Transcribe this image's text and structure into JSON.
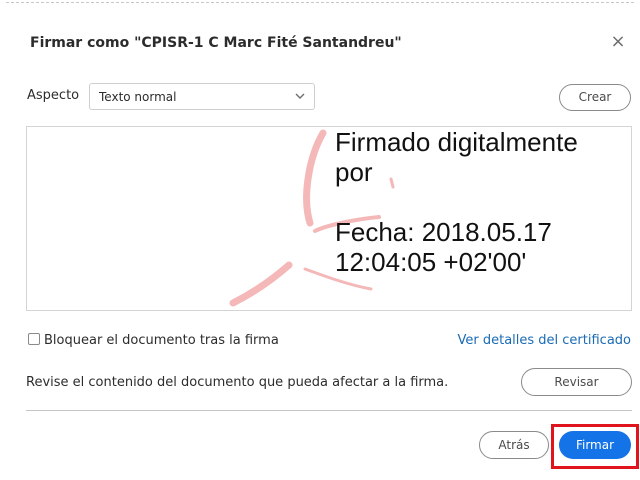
{
  "dialog": {
    "title": "Firmar como \"CPISR-1 C Marc Fité Santandreu\"",
    "close_symbol": "×"
  },
  "aspect": {
    "label": "Aspecto",
    "selected": "Texto normal",
    "create_label": "Crear"
  },
  "signature_preview": {
    "lines": [
      "Firmado digitalmente",
      "por",
      "Fecha: 2018.05.17",
      "12:04:05 +02'00'"
    ]
  },
  "options": {
    "lock_label": "Bloquear el documento tras la firma",
    "lock_checked": false,
    "certificate_link": "Ver detalles del certificado"
  },
  "review": {
    "text": "Revise el contenido del documento que pueda afectar a la firma.",
    "button_label": "Revisar"
  },
  "footer": {
    "back_label": "Atrás",
    "sign_label": "Firmar"
  },
  "colors": {
    "accent": "#1473e6",
    "link": "#1a6bb5",
    "highlight": "#e0141c",
    "watermark": "#f4b8b8"
  },
  "icons": {
    "close": "close-icon",
    "select_arrow": "chevron-down-icon",
    "watermark": "adobe-logo-icon"
  }
}
